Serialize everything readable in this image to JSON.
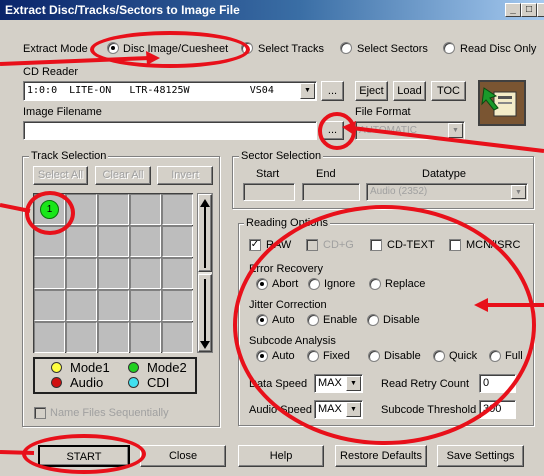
{
  "window": {
    "title": "Extract Disc/Tracks/Sectors to Image File",
    "minimize_glyph": "_",
    "maximize_glyph": "□",
    "close_glyph": "×"
  },
  "extract_mode": {
    "label": "Extract Mode",
    "options": [
      "Disc Image/Cuesheet",
      "Select Tracks",
      "Select Sectors",
      "Read Disc Only"
    ],
    "selected": "Disc Image/Cuesheet"
  },
  "cd_reader": {
    "label": "CD Reader",
    "value": "1:0:0  LITE-ON   LTR-48125W          VS04",
    "browse_label": "...",
    "eject_label": "Eject",
    "load_label": "Load",
    "toc_label": "TOC"
  },
  "image_filename": {
    "label": "Image Filename",
    "value": "",
    "browse_label": "..."
  },
  "file_format": {
    "label": "File Format",
    "value": "AUTOMATIC"
  },
  "track_selection": {
    "label": "Track Selection",
    "select_all_label": "Select All",
    "clear_all_label": "Clear All",
    "invert_label": "Invert",
    "track_1_label": "1",
    "legend": {
      "mode1": "Mode1",
      "mode2": "Mode2",
      "audio": "Audio",
      "cdi": "CDI"
    },
    "name_files_label": "Name Files Sequentially"
  },
  "sector_selection": {
    "label": "Sector Selection",
    "start_label": "Start",
    "end_label": "End",
    "datatype_label": "Datatype",
    "start_value": "",
    "end_value": "",
    "datatype_value": "Audio (2352)"
  },
  "reading_options": {
    "label": "Reading Options",
    "raw_label": "RAW",
    "cdg_label": "CD+G",
    "cdtext_label": "CD-TEXT",
    "mcn_label": "MCN/ISRC",
    "error_recovery": {
      "label": "Error Recovery",
      "options": [
        "Abort",
        "Ignore",
        "Replace"
      ],
      "selected": "Abort"
    },
    "jitter_correction": {
      "label": "Jitter Correction",
      "options": [
        "Auto",
        "Enable",
        "Disable"
      ],
      "selected": "Auto"
    },
    "subcode_analysis": {
      "label": "Subcode Analysis",
      "options": [
        "Auto",
        "Fixed",
        "Disable",
        "Quick",
        "Full"
      ],
      "selected": "Auto"
    },
    "data_speed_label": "Data Speed",
    "data_speed_value": "MAX",
    "audio_speed_label": "Audio Speed",
    "audio_speed_value": "MAX",
    "read_retry_label": "Read Retry Count",
    "read_retry_value": "0",
    "subcode_threshold_label": "Subcode Threshold",
    "subcode_threshold_value": "300"
  },
  "buttons": {
    "start": "START",
    "close": "Close",
    "help": "Help",
    "restore_defaults": "Restore Defaults",
    "save_settings": "Save Settings"
  },
  "colors": {
    "annotation_red": "#e8101a",
    "track_green": "#19e619",
    "legend_mode1": "#ffff40",
    "legend_mode2": "#20d020",
    "legend_audio": "#d01010",
    "legend_cdi": "#40e0f0"
  }
}
